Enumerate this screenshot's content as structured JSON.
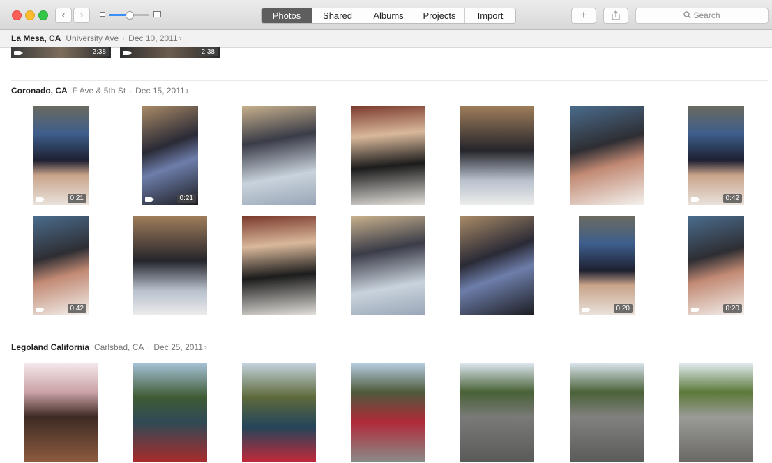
{
  "toolbar": {
    "tabs": [
      {
        "label": "Photos",
        "active": true
      },
      {
        "label": "Shared",
        "active": false
      },
      {
        "label": "Albums",
        "active": false
      },
      {
        "label": "Projects",
        "active": false
      },
      {
        "label": "Import",
        "active": false
      }
    ],
    "back_icon": "‹",
    "forward_icon": "›",
    "add_icon": "+",
    "share_icon": "share-icon",
    "search_placeholder": "Search",
    "zoom_level": 0.5
  },
  "moments": [
    {
      "location": "La Mesa, CA",
      "detail": "University Ave",
      "date": "Dec 10, 2011",
      "chevron": "›"
    },
    {
      "location": "Coronado, CA",
      "detail": "F Ave & 5th St",
      "date": "Dec 15, 2011",
      "chevron": "›"
    },
    {
      "location": "Legoland California",
      "detail": "Carlsbad, CA",
      "date": "Dec 25, 2011",
      "chevron": "›"
    }
  ],
  "separator": "·",
  "top_row_videos": [
    {
      "duration": "2:38"
    },
    {
      "duration": "2:38"
    }
  ],
  "coronado_row1": [
    {
      "type": "video",
      "duration": "0:21"
    },
    {
      "type": "video",
      "duration": "0:21"
    },
    {
      "type": "photo"
    },
    {
      "type": "photo"
    },
    {
      "type": "photo"
    },
    {
      "type": "photo"
    },
    {
      "type": "video",
      "duration": "0:42"
    }
  ],
  "coronado_row2": [
    {
      "type": "video",
      "duration": "0:42"
    },
    {
      "type": "photo"
    },
    {
      "type": "photo"
    },
    {
      "type": "photo"
    },
    {
      "type": "photo"
    },
    {
      "type": "video",
      "duration": "0:20"
    },
    {
      "type": "video",
      "duration": "0:20"
    }
  ],
  "legoland_row": [
    {
      "type": "photo"
    },
    {
      "type": "photo"
    },
    {
      "type": "photo"
    },
    {
      "type": "photo"
    },
    {
      "type": "photo"
    },
    {
      "type": "photo"
    },
    {
      "type": "photo"
    }
  ],
  "colors": {
    "active_tab": "#5e5e5e",
    "accent": "#3a8ef6"
  }
}
